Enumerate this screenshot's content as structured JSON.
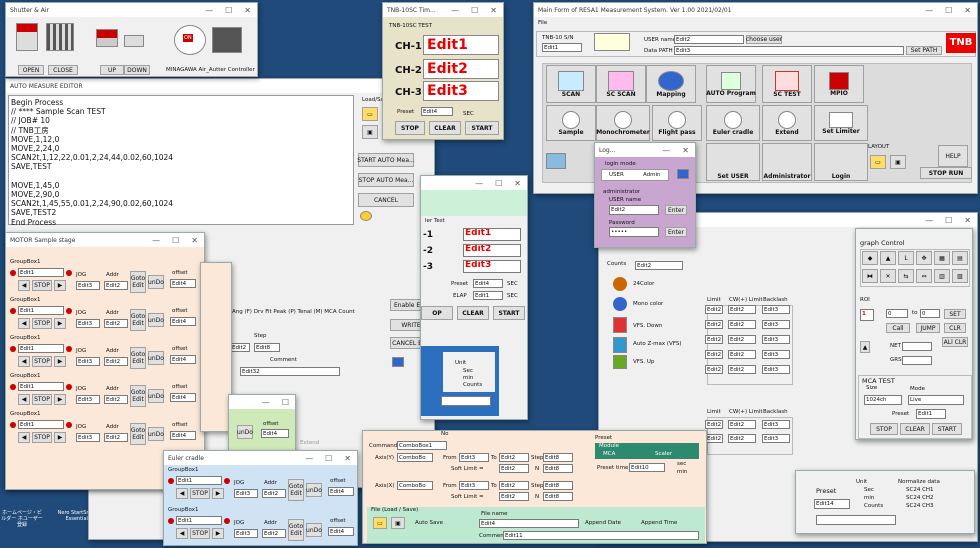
{
  "desktop": {
    "icons": [
      {
        "label": "ホームページ・ビルダー ホユーザー登録"
      },
      {
        "label": "Nero StartSmart Essentials"
      }
    ]
  },
  "shutter": {
    "title": "Shutter & Air",
    "open": "OPEN",
    "close": "CLOSE",
    "up": "UP",
    "down": "DOWN",
    "ctrl": "MINAGAWA Air_Autter Controller",
    "badge": "ON"
  },
  "tnb": {
    "title": "TNB-10SC Tim...",
    "sub": "TNB-10SC TEST",
    "ch": [
      {
        "label": "CH-1",
        "value": "Edit1"
      },
      {
        "label": "CH-2",
        "value": "Edit2"
      },
      {
        "label": "CH-3",
        "value": "Edit3"
      }
    ],
    "preset_label": "Preset",
    "preset": "Edit4",
    "sec": "SEC",
    "stop": "STOP",
    "clear": "CLEAR",
    "start": "START"
  },
  "main": {
    "title": "Main Form of RESA1 Measurement System.  Ver 1.00  2021/02/01",
    "menu": "File",
    "sn_label": "TNB-10 S/N",
    "sn": "Edit1",
    "user_label": "USER name",
    "user": "Edit2",
    "choose": "choose user",
    "path_label": "Data PATH",
    "path": "Edit3",
    "setpath": "Set PATH",
    "logo": "TNB",
    "row1": [
      "SCAN",
      "SC SCAN",
      "Mapping",
      "AUTO Program",
      "SC TEST",
      "MPIO"
    ],
    "row2": [
      "Sample",
      "Monochrometer",
      "Flight pass",
      "Euler cradle",
      "Extend",
      "Set Limiter"
    ],
    "row3": [
      "Set USER",
      "Administrator",
      "Login"
    ],
    "layout": "LAYOUT",
    "stoprun": "STOP RUN",
    "help": "HELP"
  },
  "login": {
    "title": "Log...",
    "mode": "login mode",
    "user": "USER",
    "admin": "Admin",
    "adm": "administrator",
    "uname": "USER name",
    "uval": "Edit2",
    "pw": "Password",
    "pwval": "•••••",
    "enter": "Enter"
  },
  "auto": {
    "title": "AUTO MEASURE EDITOR",
    "lines": [
      "Begin Process",
      "// **** Sample Scan TEST",
      "// JOB# 10",
      "// TNB工房",
      "MOVE,1,12,0",
      "MOVE,2,24,0",
      "SCAN2t,1,12,22,0.01,2,24,44,0.02,60,1024",
      "SAVE,TEST",
      "",
      "MOVE,1,45,0",
      "MOVE,2,90,0",
      "SCAN2t,1,45,55,0.01,2,24,90,0.02,60,1024",
      "SAVE,TEST2",
      "End Process"
    ],
    "load": "Load/Sa",
    "startauto": "START AUTO Mea...",
    "stopauto": "STOP AUTO Mea...",
    "cancel": "CANCEL",
    "enable": "Enable Edit",
    "write": "WRITE",
    "canceledit": "CANCEL Edit",
    "tabs": "Ang  (F) Drv Fit Peak  (P) Tenal  (M) MCA Count",
    "step": "Step",
    "stepv": "Edit8",
    "comment": "Comment",
    "commentv": "Edit32",
    "setv": "Edit2"
  },
  "motor": {
    "title": "MOTOR  Sample stage",
    "groups": [
      "GroupBox1",
      "GroupBox1",
      "GroupBox1",
      "GroupBox1",
      "GroupBox1"
    ],
    "edit1": "Edit1",
    "stop": "STOP",
    "jog": "JOG",
    "addr": "Addr",
    "goto": "Goto",
    "edit": "Edit",
    "undo": "unDo",
    "offset": "offset",
    "e3": "Edit3",
    "e2": "Edit2",
    "e4": "Edit4"
  },
  "euler": {
    "title": "Euler cradle"
  },
  "midwin": {
    "test": "ler Test",
    "ch": [
      "Edit1",
      "Edit2",
      "Edit3"
    ],
    "chl": [
      "-1",
      "-2",
      "-3"
    ],
    "preset": "Preset",
    "pv": "Edit4",
    "sec": "SEC",
    "elap": "ELAP",
    "ev": "Edit1",
    "stop": "OP",
    "clear": "CLEAR",
    "start": "START",
    "unit": "Unit",
    "units": [
      "Sec",
      "min",
      "Counts"
    ]
  },
  "mca": {
    "count": "Edit2",
    "c24": "24Color",
    "mono": "Mono color",
    "down": "VFS. Down",
    "auto": "Auto Z-max (VFS)",
    "up": "VFS. Up",
    "counts": "Counts",
    "limit": "Limit",
    "cw": "CW(+) Limit",
    "back": "Backlash"
  },
  "graph": {
    "title": "graph Control",
    "roi": "ROI",
    "to": "to",
    "set": "SET",
    "call": "Call",
    "jump": "JUMP",
    "clr": "CLR",
    "allclr": "ALl CLR",
    "net": "NET",
    "grs": "GRS",
    "mcatest": "MCA TEST",
    "size": "Size",
    "mode": "Mode",
    "sizev": "1024ch",
    "modev": "Live",
    "preset": "Preset",
    "pv": "Edit1",
    "stop": "STOP",
    "clear": "CLEAR",
    "start": "START",
    "unit": "Unit",
    "units": [
      "Sec",
      "min",
      "Counts"
    ],
    "norm": "Normalize data",
    "norms": [
      "SC24 CH1",
      "SC24 CH2",
      "SC24 CH3"
    ],
    "presetb": "Preset",
    "pvb": "Edit14",
    "one": "1",
    "zero": "0"
  },
  "axis": {
    "label": "No",
    "cmd": "Command",
    "combo1": "ComboBox1",
    "ay": "Axis(Y)",
    "ax": "Axis(X)",
    "combo": "ComboBo",
    "from": "From",
    "to": "To",
    "step": "Step",
    "soft": "Soft Limit =",
    "n": "N",
    "preset": "Preset",
    "module": "Module",
    "mca": "MCA",
    "scaler": "Scaler",
    "ptime": "Preset time",
    "ptv": "Edit10",
    "sec": "sec",
    "min": "min",
    "file": "File (Load / Save)",
    "fname": "File name",
    "fv": "Edit4",
    "autosave": "Auto Save",
    "appdate": "Append Date",
    "apptime": "Append Time",
    "commentl": "Comment",
    "cv": "Edit11"
  },
  "extend": {
    "label": "Extend"
  }
}
